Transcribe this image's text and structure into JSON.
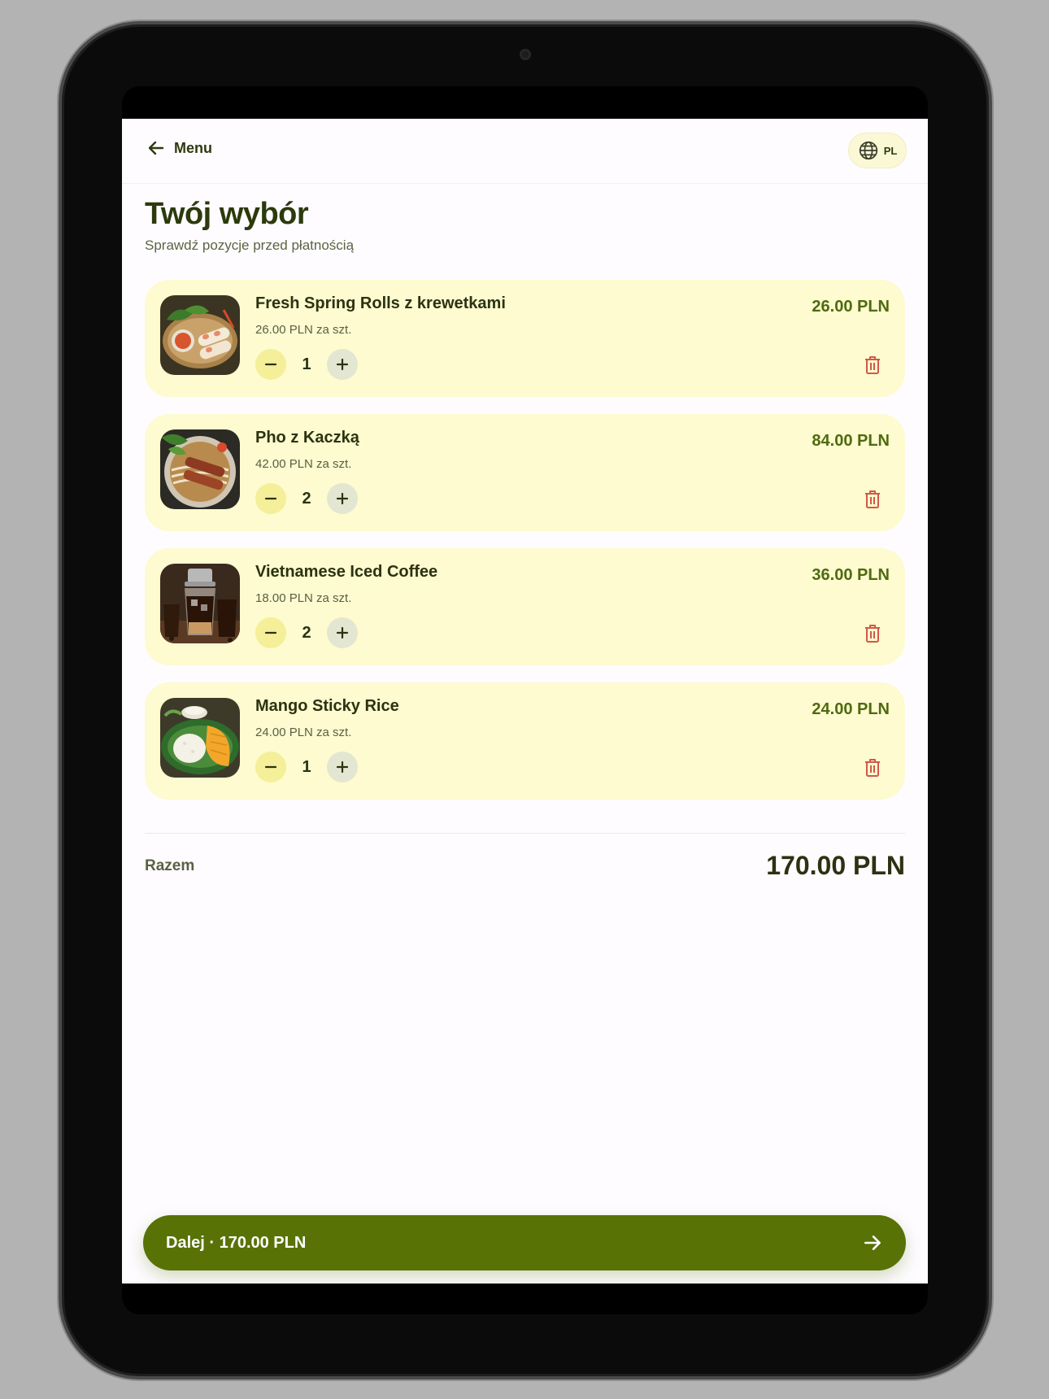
{
  "header": {
    "back_label": "Menu",
    "language": "PL"
  },
  "page": {
    "title": "Twój wybór",
    "subtitle": "Sprawdź pozycje przed płatnością"
  },
  "cart": {
    "items": [
      {
        "name": "Fresh Spring Rolls z krewetkami",
        "unit_price": "26.00 PLN za szt.",
        "quantity": "1",
        "total": "26.00 PLN",
        "image": "spring-rolls"
      },
      {
        "name": "Pho z Kaczką",
        "unit_price": "42.00 PLN za szt.",
        "quantity": "2",
        "total": "84.00 PLN",
        "image": "pho-duck"
      },
      {
        "name": "Vietnamese Iced Coffee",
        "unit_price": "18.00 PLN za szt.",
        "quantity": "2",
        "total": "36.00 PLN",
        "image": "iced-coffee"
      },
      {
        "name": "Mango Sticky Rice",
        "unit_price": "24.00 PLN za szt.",
        "quantity": "1",
        "total": "24.00 PLN",
        "image": "mango-rice"
      }
    ]
  },
  "summary": {
    "total_label": "Razem",
    "total_value": "170.00 PLN"
  },
  "cta": {
    "label": "Dalej · 170.00 PLN"
  },
  "colors": {
    "primary": "#587206",
    "card": "#fdfbcf",
    "price": "#4f6a10",
    "delete": "#d0594a"
  }
}
